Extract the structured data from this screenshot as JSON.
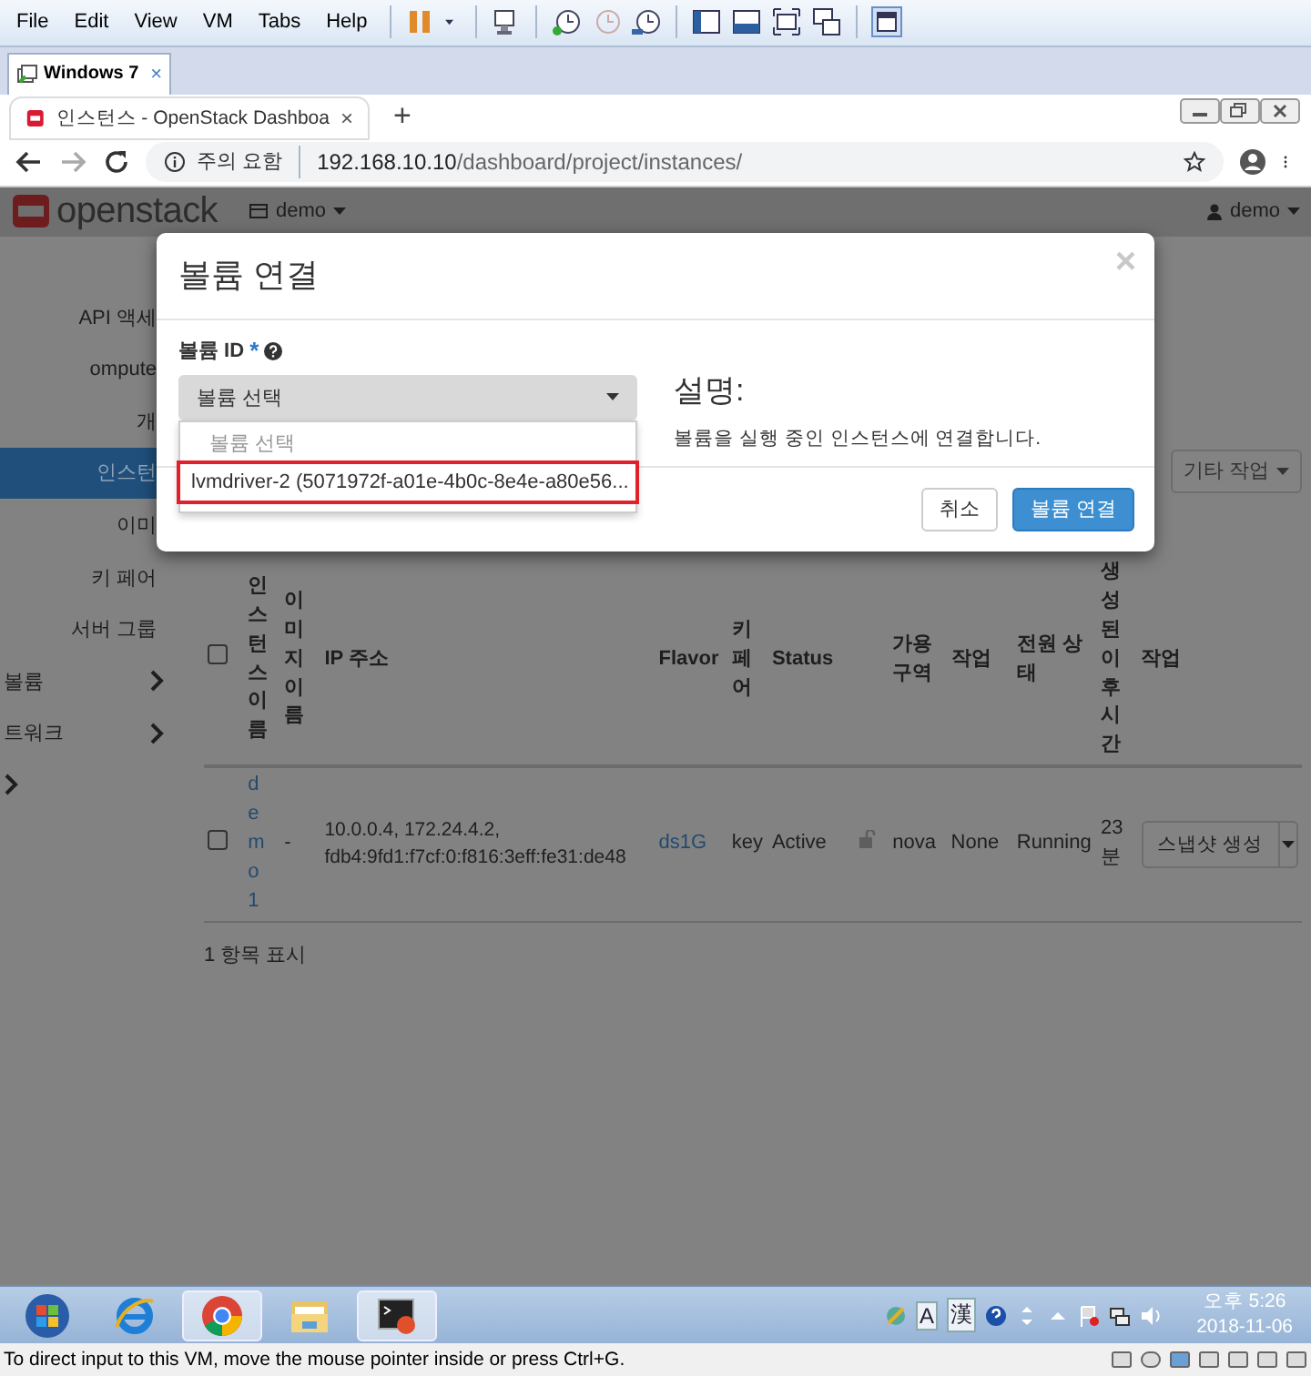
{
  "vm_menu": [
    "File",
    "Edit",
    "View",
    "VM",
    "Tabs",
    "Help"
  ],
  "vm_tab": {
    "title": "Windows 7",
    "close": "×"
  },
  "browser_tab": {
    "title": "인스턴스 - OpenStack Dashboa",
    "close": "×",
    "new_tab": "+"
  },
  "address": {
    "security": "주의 요함",
    "host": "192.168.10.10",
    "path": "/dashboard/project/instances/"
  },
  "header": {
    "logo": "openstack",
    "project": "demo",
    "user": "demo"
  },
  "sidebar": [
    {
      "label": "API 액세",
      "selected": false,
      "chevron": false
    },
    {
      "label": "ompute",
      "selected": false,
      "chevron": false
    },
    {
      "label": "개",
      "selected": false,
      "chevron": false
    },
    {
      "label": "인스턴",
      "selected": true,
      "chevron": false
    },
    {
      "label": "이미",
      "selected": false,
      "chevron": false
    },
    {
      "label": "키 페어",
      "selected": false,
      "chevron": false
    },
    {
      "label": "서버 그룹",
      "selected": false,
      "chevron": false
    },
    {
      "label": "볼륨",
      "selected": false,
      "chevron": true
    },
    {
      "label": "트워크",
      "selected": false,
      "chevron": true
    },
    {
      "selected": false,
      "chevron": true
    }
  ],
  "actions": {
    "more": "기타 작업"
  },
  "table": {
    "select_all": false,
    "columns": [
      "인스턴스 이름",
      "이미지 이름",
      "IP 주소",
      "Flavor",
      "키 페어",
      "Status",
      "가용 구역",
      "작업",
      "전원 상태",
      "생성된 이후 시간",
      "작업"
    ],
    "rows": [
      {
        "checked": false,
        "name": "demo1",
        "image": "-",
        "ip": "10.0.0.4, 172.24.4.2, fdb4:9fd1:f7cf:0:f816:3eff:fe31:de48",
        "flavor": "ds1G",
        "key": "key",
        "status": "Active",
        "locked": false,
        "zone": "nova",
        "task": "None",
        "power": "Running",
        "age": "23 분",
        "action": "스냅샷 생성"
      }
    ],
    "footer": "1 항목 표시"
  },
  "modal": {
    "title": "볼륨 연결",
    "close": "×",
    "field_label": "볼륨 ID",
    "required": "*",
    "select": {
      "value": "볼륨 선택",
      "expanded": true,
      "options": [
        {
          "label": "볼륨 선택",
          "highlighted": false
        },
        {
          "label": "lvmdriver-2 (5071972f-a01e-4b0c-8e4e-a80e56...",
          "highlighted": true
        }
      ]
    },
    "description_title": "설명:",
    "description": "볼륨을 실행 중인 인스턴스에 연결합니다.",
    "cancel": "취소",
    "submit": "볼륨 연결"
  },
  "taskbar": {
    "ime": [
      "A",
      "漢"
    ],
    "time": "오후 5:26",
    "date": "2018-11-06"
  },
  "status_bar": "To direct input to this VM, move the mouse pointer inside or press Ctrl+G."
}
